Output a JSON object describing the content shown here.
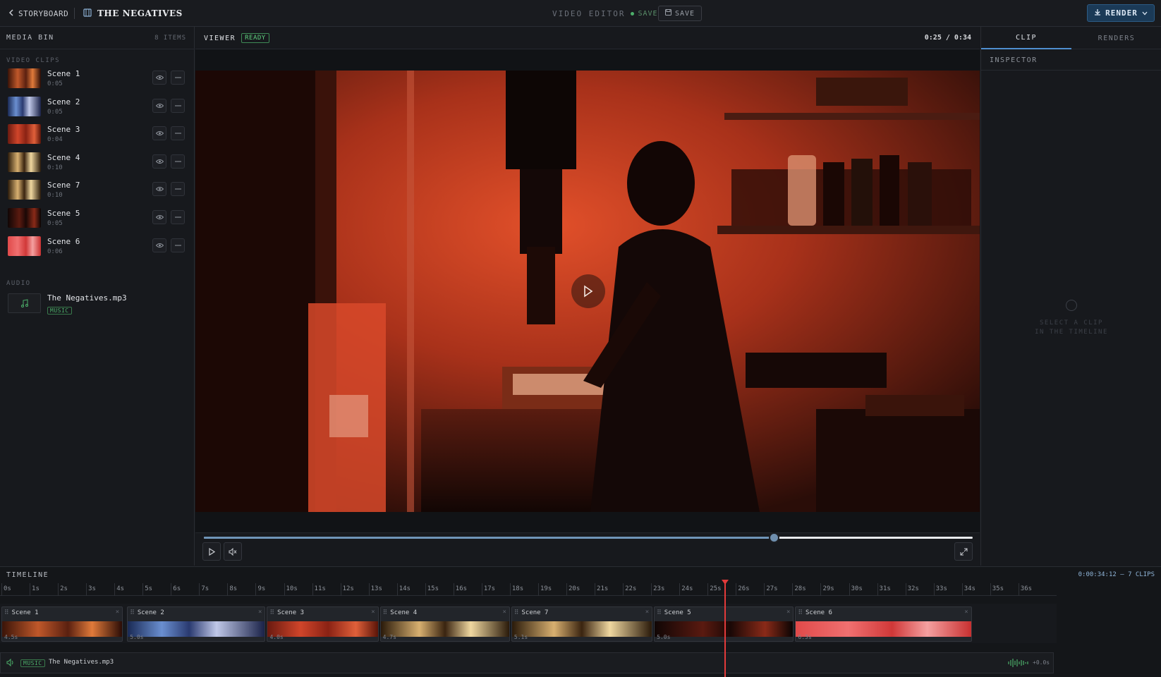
{
  "topbar": {
    "back_label": "STORYBOARD",
    "project_title": "THE NEGATIVES",
    "editor_label": "VIDEO EDITOR",
    "saved_label": "SAVED",
    "save_label": "SAVE",
    "render_label": "RENDER"
  },
  "media_bin": {
    "title": "MEDIA BIN",
    "count": "8 ITEMS",
    "video_section": "VIDEO CLIPS",
    "clips": [
      {
        "name": "Scene 1",
        "duration": "0:05",
        "thumb": "warm"
      },
      {
        "name": "Scene 2",
        "duration": "0:05",
        "thumb": "blue"
      },
      {
        "name": "Scene 3",
        "duration": "0:04",
        "thumb": "red"
      },
      {
        "name": "Scene 4",
        "duration": "0:10",
        "thumb": "gold"
      },
      {
        "name": "Scene 7",
        "duration": "0:10",
        "thumb": "gold"
      },
      {
        "name": "Scene 5",
        "duration": "0:05",
        "thumb": "dark"
      },
      {
        "name": "Scene 6",
        "duration": "0:06",
        "thumb": "bright"
      }
    ],
    "audio_section": "AUDIO",
    "audio": {
      "name": "The Negatives.mp3",
      "badge": "MUSIC"
    }
  },
  "viewer": {
    "title": "VIEWER",
    "status": "READY",
    "time": "0:25 / 0:34",
    "progress": 0.742
  },
  "inspector": {
    "tabs": [
      "CLIP",
      "RENDERS"
    ],
    "active_tab": "CLIP",
    "title": "INSPECTOR",
    "empty_line1": "SELECT A CLIP",
    "empty_line2": "IN THE TIMELINE"
  },
  "timeline": {
    "title": "TIMELINE",
    "info": "0:00:34:12 — 7 CLIPS",
    "playhead_seconds": 25.6,
    "ruler": [
      "0s",
      "1s",
      "2s",
      "3s",
      "4s",
      "5s",
      "6s",
      "7s",
      "8s",
      "9s",
      "10s",
      "11s",
      "12s",
      "13s",
      "14s",
      "15s",
      "16s",
      "17s",
      "18s",
      "19s",
      "20s",
      "21s",
      "22s",
      "23s",
      "24s",
      "25s",
      "26s",
      "27s",
      "28s",
      "29s",
      "30s",
      "31s",
      "32s",
      "33s",
      "34s",
      "35s",
      "36s"
    ],
    "clips": [
      {
        "name": "Scene 1",
        "duration": "4.5s",
        "start": 0.0,
        "length": 4.3,
        "tone": "warm"
      },
      {
        "name": "Scene 2",
        "duration": "5.0s",
        "start": 4.45,
        "length": 4.9,
        "tone": "blue"
      },
      {
        "name": "Scene 3",
        "duration": "4.0s",
        "start": 9.4,
        "length": 3.95,
        "tone": "red"
      },
      {
        "name": "Scene 4",
        "duration": "4.7s",
        "start": 13.4,
        "length": 4.6,
        "tone": "gold"
      },
      {
        "name": "Scene 7",
        "duration": "5.1s",
        "start": 18.05,
        "length": 5.0,
        "tone": "gold"
      },
      {
        "name": "Scene 5",
        "duration": "5.0s",
        "start": 23.1,
        "length": 4.95,
        "tone": "dark"
      },
      {
        "name": "Scene 6",
        "duration": "6.3s",
        "start": 28.1,
        "length": 6.25,
        "tone": "bright"
      }
    ],
    "audio": {
      "badge": "MUSIC",
      "name": "The Negatives.mp3",
      "offset": "+0.0s"
    }
  }
}
